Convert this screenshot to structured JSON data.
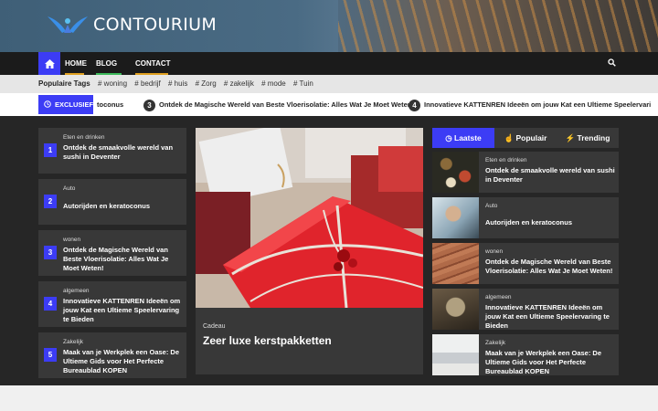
{
  "site": {
    "name": "CONTOURIUM"
  },
  "nav": {
    "home": "HOME",
    "blog": "BLOG",
    "contact": "CONTACT"
  },
  "tags": {
    "label": "Populaire Tags",
    "items": [
      "# woning",
      "# bedrijf",
      "# huis",
      "# Zorg",
      "# zakelijk",
      "# mode",
      "# Tuin"
    ]
  },
  "ticker": {
    "label": "EXCLUSIEF",
    "items": [
      {
        "num": "",
        "text": "toconus"
      },
      {
        "num": "3",
        "text": "Ontdek de Magische Wereld van Beste Vloerisolatie: Alles Wat Je Moet Weten!"
      },
      {
        "num": "4",
        "text": "Innovatieve KATTENREN Ideeën om jouw Kat een Ultieme Speelervari"
      }
    ]
  },
  "left_list": [
    {
      "num": "1",
      "category": "Eten en drinken",
      "title": "Ontdek de smaakvolle wereld van sushi in Deventer"
    },
    {
      "num": "2",
      "category": "Auto",
      "title": "Autorijden en keratoconus"
    },
    {
      "num": "3",
      "category": "wonen",
      "title": "Ontdek de Magische Wereld van Beste Vloerisolatie: Alles Wat Je Moet Weten!"
    },
    {
      "num": "4",
      "category": "algemeen",
      "title": "Innovatieve KATTENREN Ideeën om jouw Kat een Ultieme Speelervaring te Bieden"
    },
    {
      "num": "5",
      "category": "Zakelijk",
      "title": "Maak van je Werkplek een Oase: De Ultieme Gids voor Het Perfecte Bureaublad KOPEN"
    }
  ],
  "feature": {
    "category": "Cadeau",
    "title": "Zeer luxe kerstpakketten"
  },
  "tabs": {
    "latest": "Laatste",
    "popular": "Populair",
    "trending": "Trending"
  },
  "right_list": [
    {
      "category": "Eten en drinken",
      "title": "Ontdek de smaakvolle wereld van sushi in Deventer"
    },
    {
      "category": "Auto",
      "title": "Autorijden en keratoconus"
    },
    {
      "category": "wonen",
      "title": "Ontdek de Magische Wereld van Beste Vloerisolatie: Alles Wat Je Moet Weten!"
    },
    {
      "category": "algemeen",
      "title": "Innovatieve KATTENREN Ideeën om jouw Kat een Ultieme Speelervaring te Bieden"
    },
    {
      "category": "Zakelijk",
      "title": "Maak van je Werkplek een Oase: De Ultieme Gids voor Het Perfecte Bureaublad KOPEN"
    }
  ],
  "colors": {
    "accent": "#3c3cf5",
    "dark": "#262626",
    "card": "#383838"
  }
}
